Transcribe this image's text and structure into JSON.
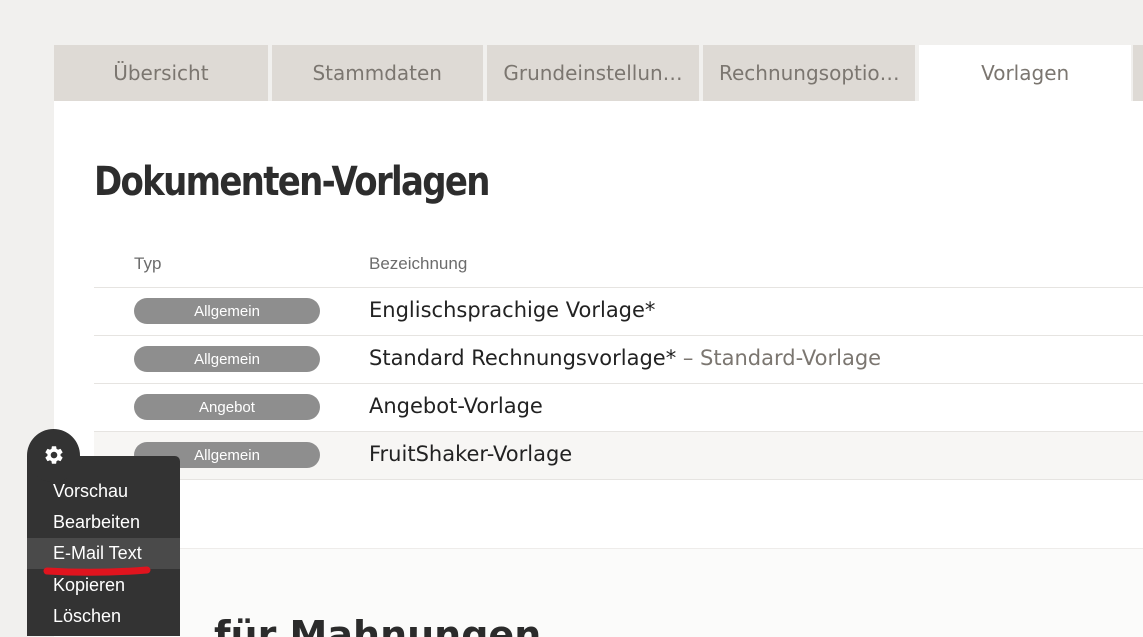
{
  "tabs": [
    {
      "label": "Übersicht"
    },
    {
      "label": "Stammdaten"
    },
    {
      "label": "Grundeinstellun…"
    },
    {
      "label": "Rechnungsoptio…"
    },
    {
      "label": "Vorlagen",
      "active": true
    }
  ],
  "page": {
    "title": "Dokumenten-Vorlagen"
  },
  "table": {
    "headers": {
      "type": "Typ",
      "name": "Bezeichnung"
    },
    "rows": [
      {
        "type": "Allgemein",
        "name": "Englischsprachige Vorlage*",
        "note": ""
      },
      {
        "type": "Allgemein",
        "name": "Standard Rechnungsvorlage*",
        "note": " – Standard-Vorlage"
      },
      {
        "type": "Angebot",
        "name": "Angebot-Vorlage",
        "note": ""
      },
      {
        "type": "Allgemein",
        "name": "FruitShaker-Vorlage",
        "note": ""
      }
    ]
  },
  "context_menu": {
    "icon": "gear-icon",
    "items": [
      {
        "label": "Vorschau"
      },
      {
        "label": "Bearbeiten"
      },
      {
        "label": "E-Mail Text",
        "highlighted": true
      },
      {
        "label": "Kopieren"
      },
      {
        "label": "Löschen"
      }
    ]
  },
  "lower_section": {
    "title_partial": "für Mahnungen"
  },
  "colors": {
    "tab_bg": "#dedad5",
    "badge_bg": "#8e8e8e",
    "menu_bg": "#333333",
    "annotation_red": "#e0141e"
  }
}
